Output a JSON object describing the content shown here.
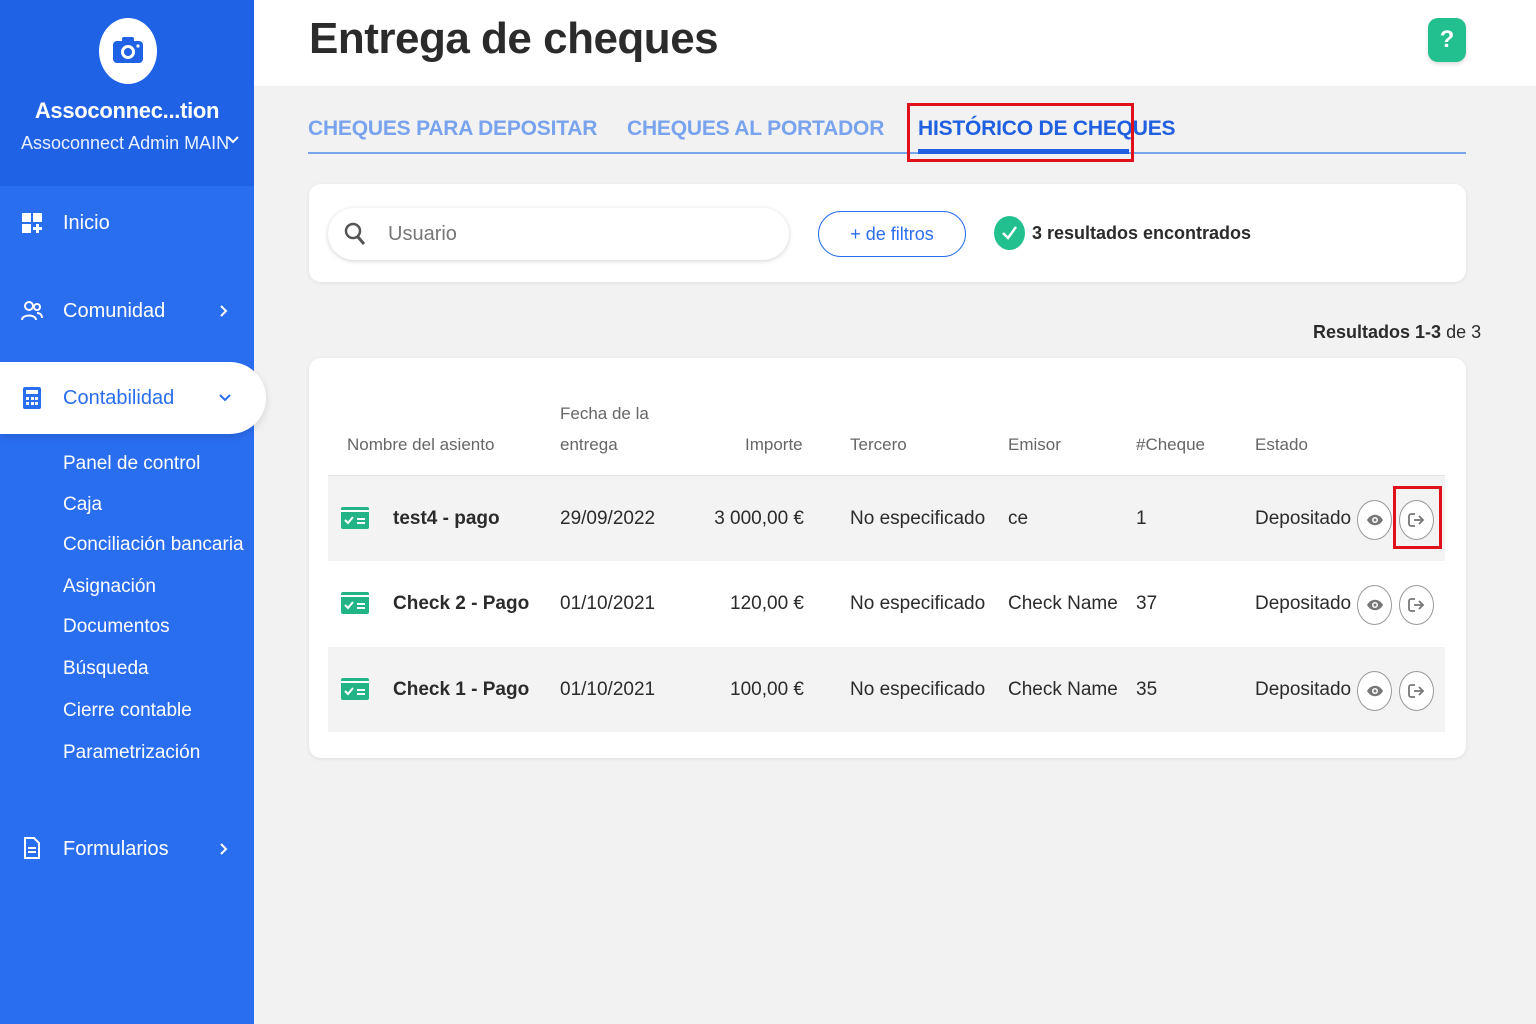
{
  "sidebar": {
    "org_name": "Assoconnec...tion",
    "org_subtitle": "Assoconnect Admin MAIN",
    "nav": {
      "inicio": "Inicio",
      "comunidad": "Comunidad",
      "contabilidad": "Contabilidad",
      "formularios": "Formularios"
    },
    "sub_items": [
      "Panel de control",
      "Caja",
      "Conciliación bancaria",
      "Asignación",
      "Documentos",
      "Búsqueda",
      "Cierre contable",
      "Parametrización"
    ]
  },
  "header": {
    "title": "Entrega de cheques",
    "help": "?"
  },
  "tabs": [
    "CHEQUES PARA DEPOSITAR",
    "CHEQUES AL PORTADOR",
    "HISTÓRICO DE CHEQUES"
  ],
  "active_tab": "HISTÓRICO DE CHEQUES",
  "filters": {
    "search_placeholder": "Usuario",
    "more_filters": "+ de filtros",
    "results_found": "3 resultados encontrados"
  },
  "results_count": {
    "label": "Resultados 1-3",
    "of": "de 3"
  },
  "table": {
    "headers": {
      "name": "Nombre del asiento",
      "date_line1": "Fecha de la",
      "date_line2": "entrega",
      "amount": "Importe",
      "third": "Tercero",
      "issuer": "Emisor",
      "cheque": "#Cheque",
      "status": "Estado"
    },
    "rows": [
      {
        "name": "test4 - pago",
        "date": "29/09/2022",
        "amount": "3 000,00 €",
        "third": "No especificado",
        "issuer": "ce",
        "cheque": "1",
        "status": "Depositado"
      },
      {
        "name": "Check 2 - Pago",
        "date": "01/10/2021",
        "amount": "120,00 €",
        "third": "No especificado",
        "issuer": "Check Name",
        "cheque": "37",
        "status": "Depositado"
      },
      {
        "name": "Check 1 - Pago",
        "date": "01/10/2021",
        "amount": "100,00 €",
        "third": "No especificado",
        "issuer": "Check Name",
        "cheque": "35",
        "status": "Depositado"
      }
    ]
  },
  "colors": {
    "sidebar": "#2a6ef0",
    "accent": "#1f5fe0",
    "success": "#22c08e",
    "highlight": "#e0111b"
  },
  "icons": [
    "camera-icon",
    "chevron-down-icon",
    "dashboard-icon",
    "community-icon",
    "calculator-icon",
    "document-icon",
    "search-icon",
    "check-icon",
    "cheque-icon",
    "eye-icon",
    "exit-icon",
    "help-icon"
  ]
}
